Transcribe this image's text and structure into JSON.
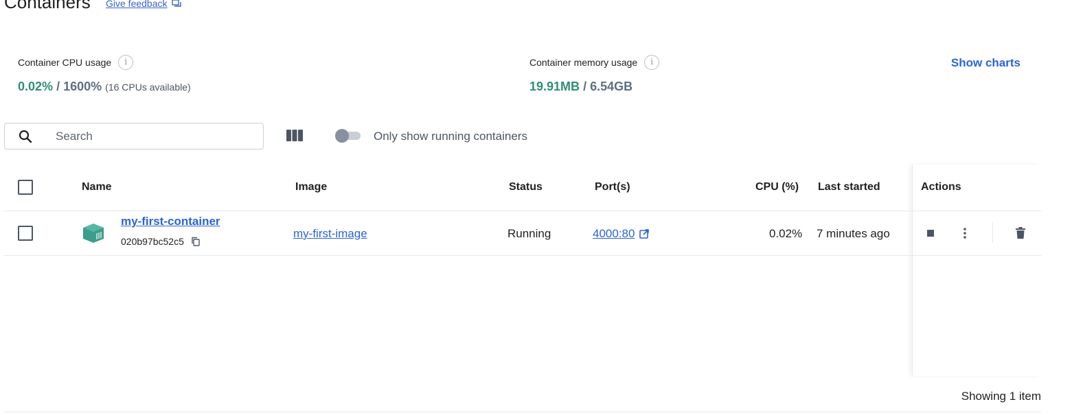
{
  "header": {
    "title": "Containers",
    "feedback_label": "Give feedback"
  },
  "stats": {
    "cpu": {
      "label": "Container CPU usage",
      "value": "0.02%",
      "separator": "/",
      "total": "1600%",
      "note": "(16 CPUs available)"
    },
    "memory": {
      "label": "Container memory usage",
      "value": "19.91MB",
      "separator": "/",
      "total": "6.54GB"
    },
    "show_charts_label": "Show charts"
  },
  "toolbar": {
    "search_placeholder": "Search",
    "search_value": "",
    "toggle_label": "Only show running containers",
    "toggle_on": false
  },
  "table": {
    "headers": {
      "name": "Name",
      "image": "Image",
      "status": "Status",
      "ports": "Port(s)",
      "cpu": "CPU (%)",
      "last_started": "Last started",
      "actions": "Actions"
    },
    "rows": [
      {
        "name": "my-first-container",
        "id": "020b97bc52c5",
        "image": "my-first-image",
        "status": "Running",
        "ports": "4000:80",
        "cpu": "0.02%",
        "last_started": "7 minutes ago"
      }
    ],
    "footer": "Showing 1 item"
  },
  "colors": {
    "accent": "#2b63d9",
    "running_green": "#2f8f73",
    "container_icon": "#3a9e8a"
  },
  "icons": {
    "search": "search-icon",
    "columns": "columns-icon",
    "info": "info-icon",
    "copy": "copy-icon",
    "external_link": "external-link-icon",
    "stop": "stop-icon",
    "more": "more-vertical-icon",
    "delete": "trash-icon",
    "container": "container-icon",
    "feedback": "feedback-icon"
  }
}
